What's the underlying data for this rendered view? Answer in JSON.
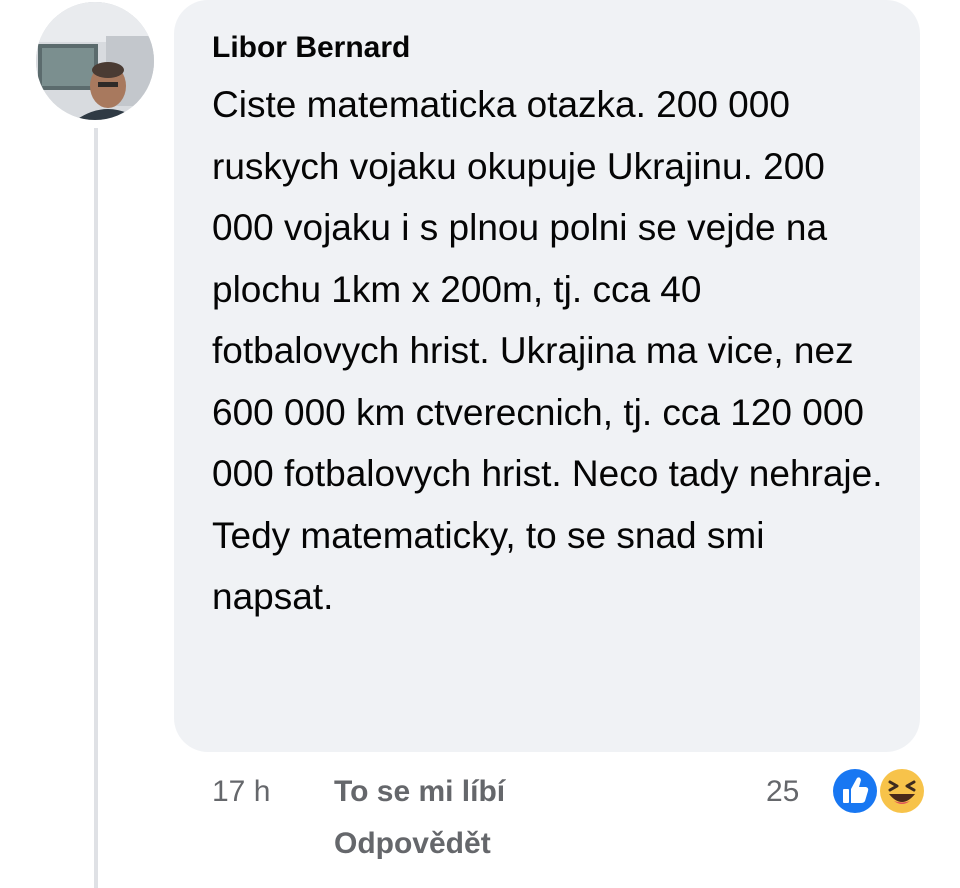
{
  "comment": {
    "author": "Libor Bernard",
    "text": "Ciste matematicka otazka. 200 000 ruskych vojaku okupuje Ukrajinu. 200 000 vojaku i s plnou polni se vejde na plochu 1km x 200m, tj. cca 40 fotbalovych hrist. Ukrajina ma vice, nez 600 000 km ctverecnich, tj. cca 120 000 000 fotbalovych hrist. Neco tady nehraje. Tedy matematicky, to se snad smi napsat.",
    "time": "17 h",
    "like_label": "To se mi líbí",
    "reply_label": "Odpovědět",
    "reaction_count": "25",
    "reactions": [
      "like-icon",
      "haha-icon"
    ]
  },
  "colors": {
    "bubble": "#f0f2f5",
    "meta_text": "#65676b",
    "like_blue": "#1877f2",
    "haha_yellow": "#f7c34a"
  }
}
